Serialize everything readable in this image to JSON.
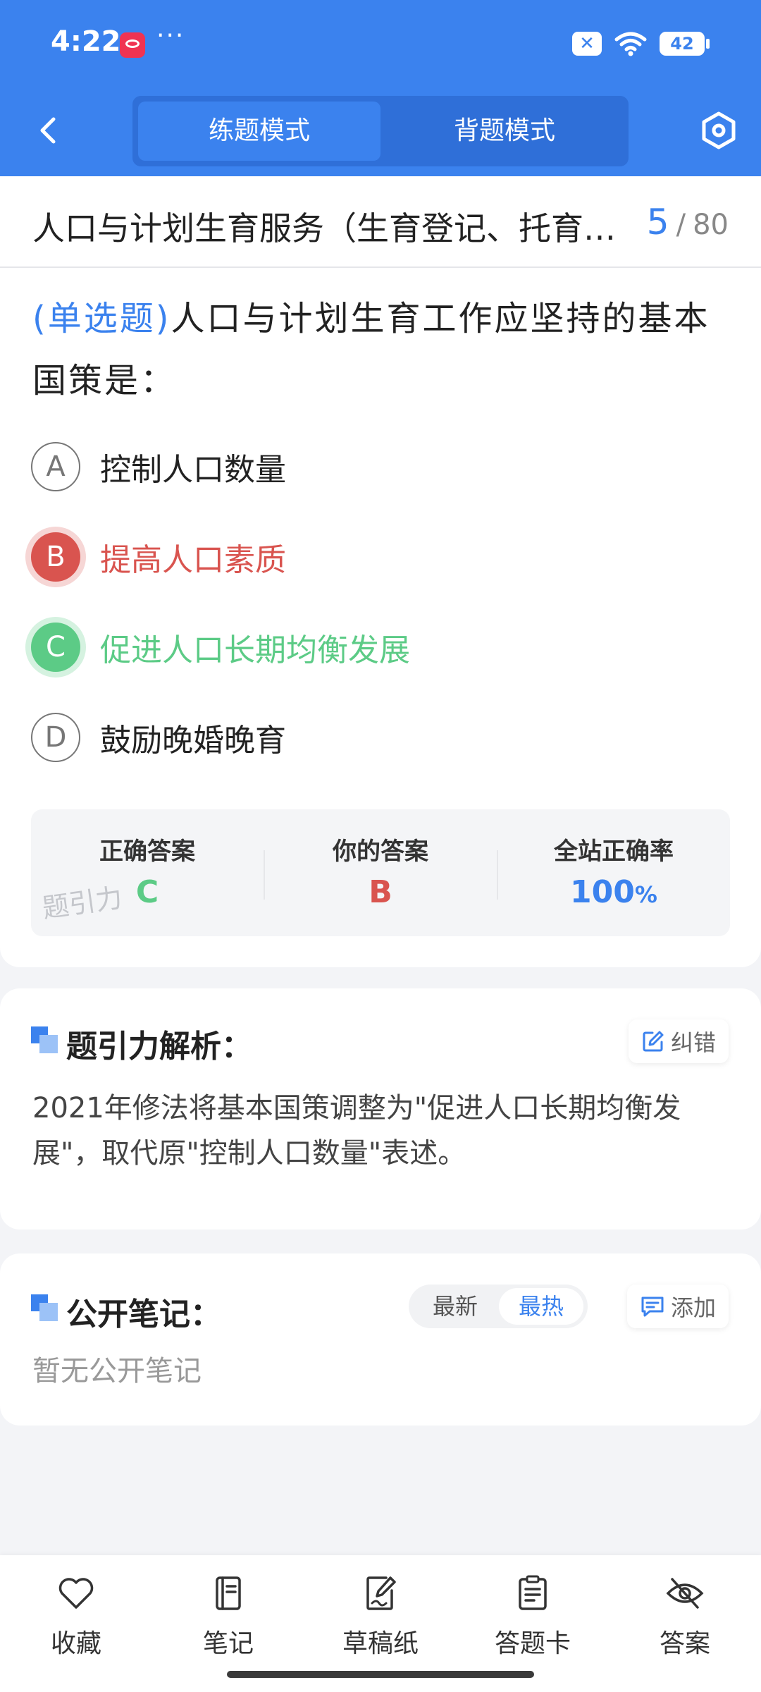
{
  "status_bar": {
    "time": "4:22",
    "dots": "···",
    "battery": "42"
  },
  "nav": {
    "mode_practice": "练题模式",
    "mode_recite": "背题模式"
  },
  "header": {
    "chapter_title": "人口与计划生育服务（生育登记、托育…",
    "current": "5",
    "separator": "/",
    "total": "80"
  },
  "question": {
    "type": "(单选题)",
    "text": "人口与计划生育工作应坚持的基本国策是：",
    "options": [
      {
        "letter": "A",
        "text": "控制人口数量",
        "state": "normal"
      },
      {
        "letter": "B",
        "text": "提高人口素质",
        "state": "wrong"
      },
      {
        "letter": "C",
        "text": "促进人口长期均衡发展",
        "state": "correct"
      },
      {
        "letter": "D",
        "text": "鼓励晚婚晚育",
        "state": "normal"
      }
    ]
  },
  "answer": {
    "correct_label": "正确答案",
    "correct_value": "C",
    "yours_label": "你的答案",
    "yours_value": "B",
    "rate_label": "全站正确率",
    "rate_value": "100",
    "rate_unit": "%",
    "watermark": "题引力"
  },
  "analysis": {
    "title": "题引力解析：",
    "report_label": "纠错",
    "text": "2021年修法将基本国策调整为\"促进人口长期均衡发展\"，取代原\"控制人口数量\"表述。"
  },
  "notes": {
    "title": "公开笔记：",
    "sort_latest": "最新",
    "sort_hot": "最热",
    "add_label": "添加",
    "empty": "暂无公开笔记"
  },
  "tabs": [
    {
      "label": "收藏",
      "icon": "heart-icon"
    },
    {
      "label": "笔记",
      "icon": "notebook-icon"
    },
    {
      "label": "草稿纸",
      "icon": "draft-icon"
    },
    {
      "label": "答题卡",
      "icon": "answer-sheet-icon"
    },
    {
      "label": "答案",
      "icon": "eye-off-icon"
    }
  ],
  "colors": {
    "primary": "#3b82ee",
    "wrong": "#d9544f",
    "correct": "#5ccb86",
    "background": "#f3f4f7"
  }
}
